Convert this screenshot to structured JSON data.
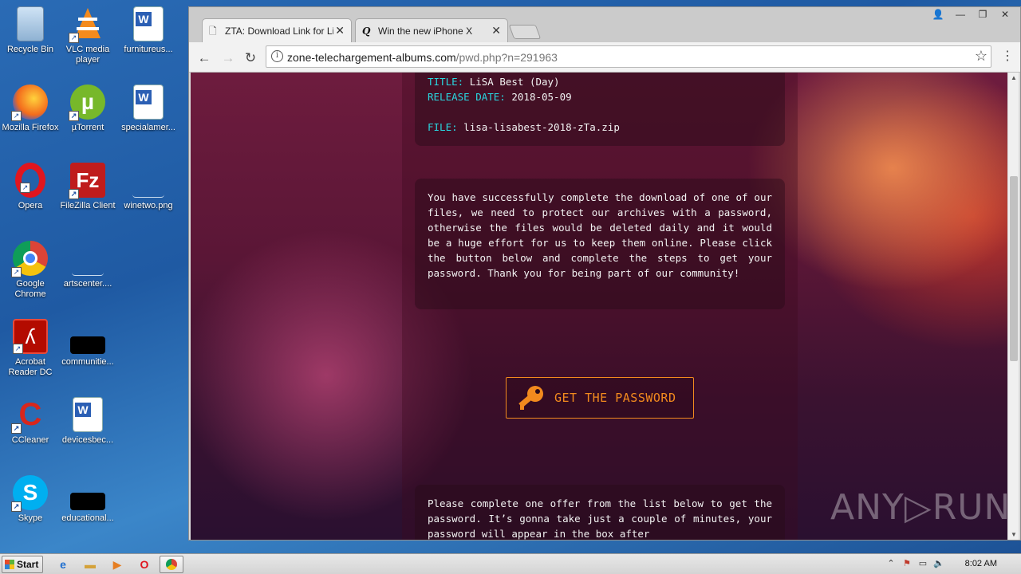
{
  "desktop": {
    "icons": [
      {
        "label": "Recycle Bin",
        "icon": "recycle-bin-icon"
      },
      {
        "label": "VLC media player",
        "icon": "vlc-icon"
      },
      {
        "label": "furnitureus...",
        "icon": "word-doc-icon"
      },
      {
        "label": "Mozilla Firefox",
        "icon": "firefox-icon"
      },
      {
        "label": "µTorrent",
        "icon": "utorrent-icon"
      },
      {
        "label": "specialamer...",
        "icon": "word-doc-icon"
      },
      {
        "label": "Opera",
        "icon": "opera-icon"
      },
      {
        "label": "FileZilla Client",
        "icon": "filezilla-icon"
      },
      {
        "label": "winetwo.png",
        "icon": "image-file-icon"
      },
      {
        "label": "Google Chrome",
        "icon": "chrome-icon"
      },
      {
        "label": "artscenter....",
        "icon": "file-icon"
      },
      {
        "label": "Acrobat Reader DC",
        "icon": "acrobat-icon"
      },
      {
        "label": "communitie...",
        "icon": "black-file-icon"
      },
      {
        "label": "CCleaner",
        "icon": "ccleaner-icon"
      },
      {
        "label": "devicesbec...",
        "icon": "word-doc-icon"
      },
      {
        "label": "Skype",
        "icon": "skype-icon"
      },
      {
        "label": "educational...",
        "icon": "black-file-icon"
      }
    ]
  },
  "browser": {
    "tabs": [
      {
        "title": "ZTA: Download Link for Lisà",
        "active": true,
        "icon": "page-icon"
      },
      {
        "title": "Win the new iPhone X",
        "active": false,
        "icon": "q-logo-icon"
      }
    ],
    "url_host": "zone-telechargement-albums.com",
    "url_path": "/pwd.php?n=291963"
  },
  "page": {
    "title_key": "TITLE:",
    "title_value": "LiSA Best (Day)",
    "release_key": "RELEASE DATE:",
    "release_value": "2018-05-09",
    "file_key": "FILE:",
    "file_value": "lisa-lisabest-2018-zTa.zip",
    "message": "You have successfully complete the download of one of our files, we need to protect our archives with a password, otherwise the files would be deleted daily and it would be a huge effort for us to keep them online. Please click the button below and complete the steps to get your password. Thank you for being part of our community!",
    "button_label": "GET THE PASSWORD",
    "offer_text": "Please complete one offer from the list below to get the password. It’s gonna take just a couple of minutes, your password will appear in the box after",
    "accent_color": "#f28a1e",
    "key_color": "#29d7e0"
  },
  "watermark": "ANY▷RUN",
  "taskbar": {
    "start_label": "Start",
    "clock": "8:02 AM"
  }
}
